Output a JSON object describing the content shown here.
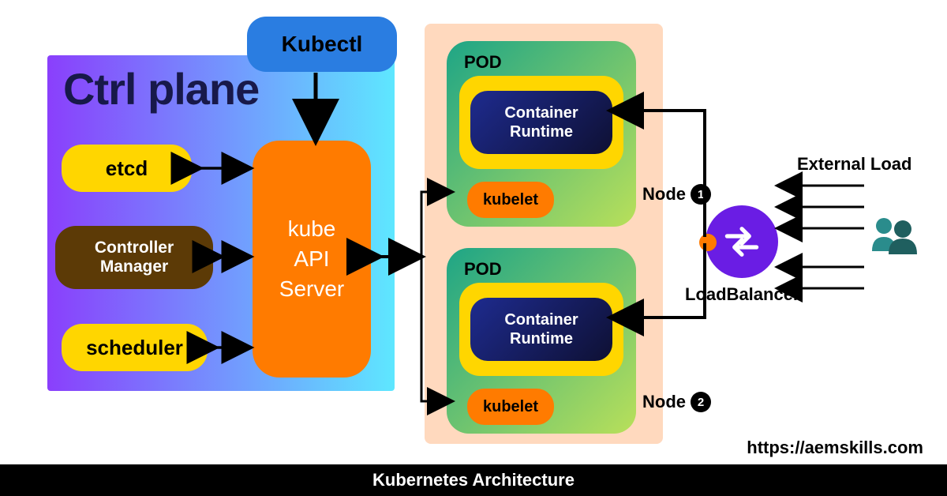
{
  "title": "Kubernetes Architecture",
  "url": "https://aemskills.com",
  "ctrl_plane": {
    "heading": "Ctrl plane",
    "etcd": "etcd",
    "controller_l1": "Controller",
    "controller_l2": "Manager",
    "scheduler": "scheduler",
    "api_l1": "kube",
    "api_l2": "API",
    "api_l3": "Server"
  },
  "kubectl": "Kubectl",
  "node": {
    "pod_label": "POD",
    "runtime_l1": "Container",
    "runtime_l2": "Runtime",
    "kubelet": "kubelet",
    "tag": "Node",
    "n1": "1",
    "n2": "2"
  },
  "lb": {
    "label": "LoadBalancer",
    "ext": "External Load"
  }
}
